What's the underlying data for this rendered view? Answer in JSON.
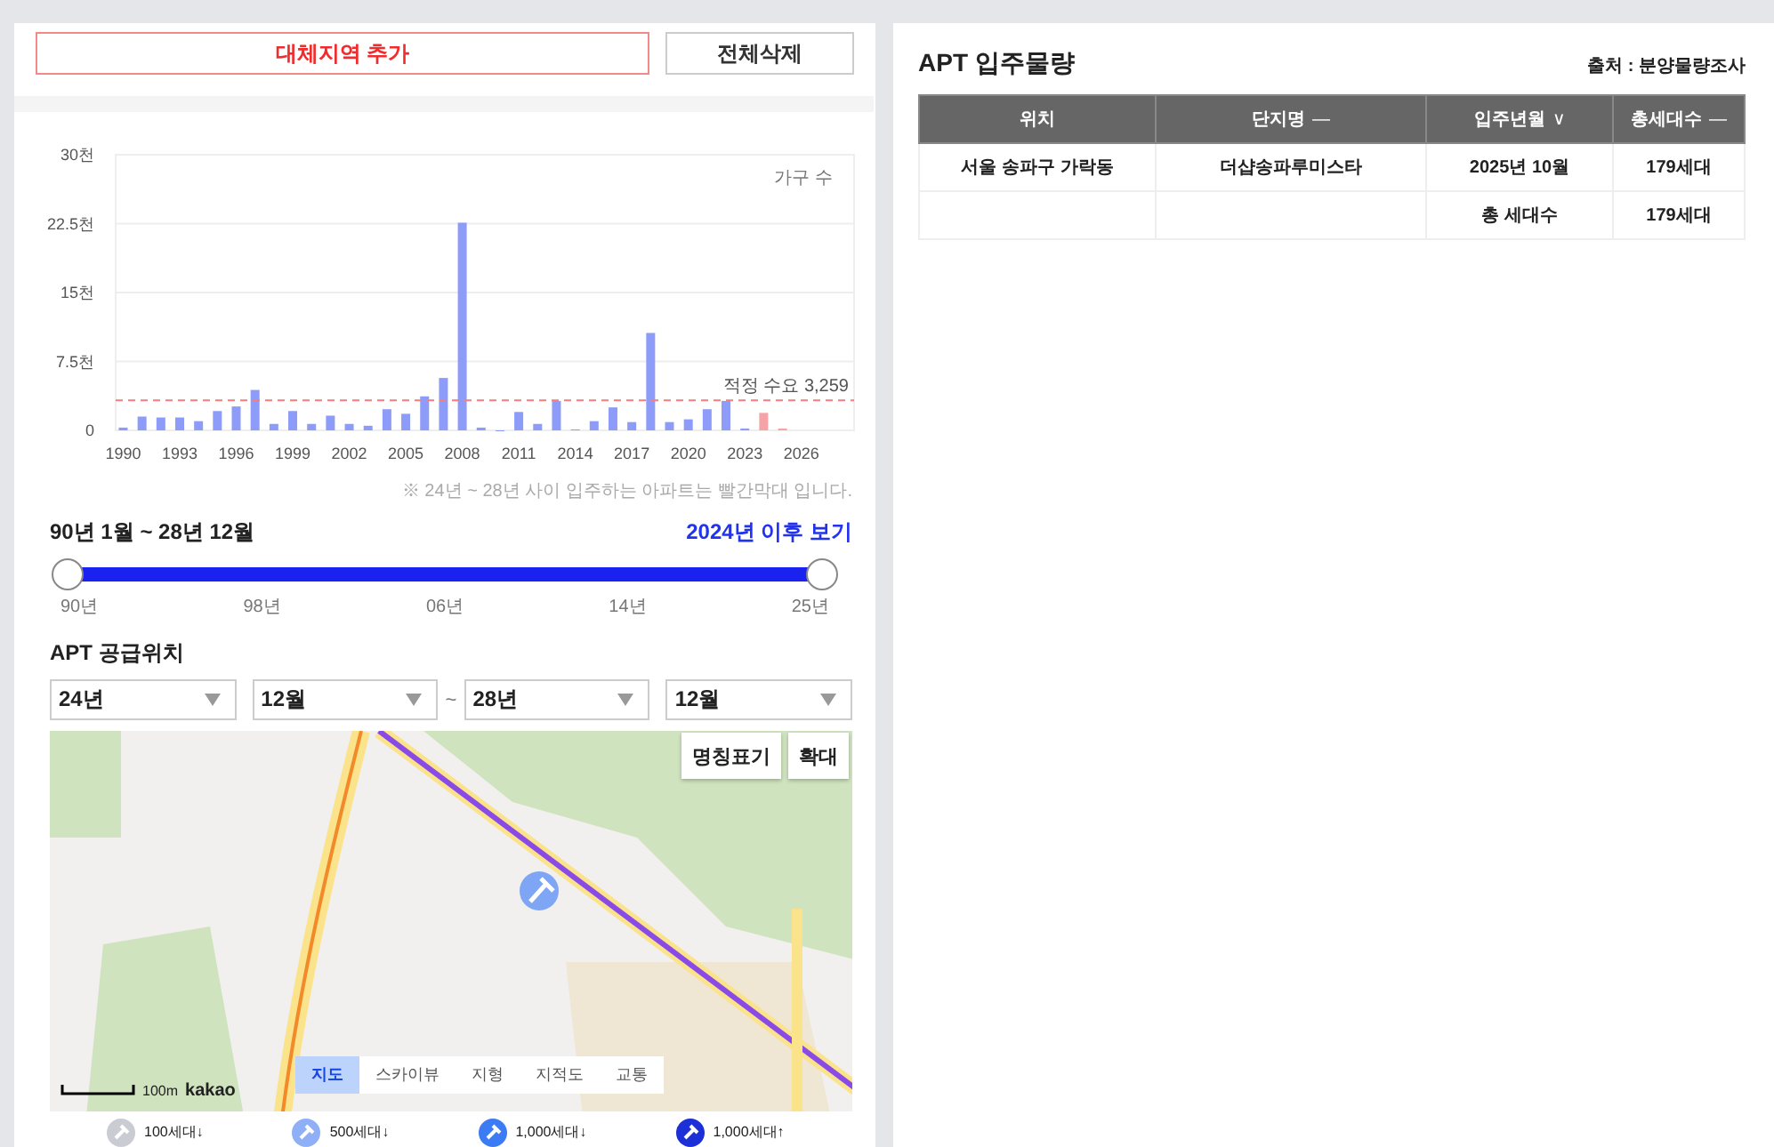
{
  "left_panel": {
    "buttons": [
      {
        "label": "대체지역 추가",
        "kind": "primary"
      },
      {
        "label": "전체삭제",
        "kind": "plain"
      }
    ],
    "chart": {
      "chart_data": {
        "type": "bar",
        "ylabel": "가구 수",
        "x": [
          1990,
          1991,
          1992,
          1993,
          1994,
          1995,
          1996,
          1997,
          1998,
          1999,
          2000,
          2001,
          2002,
          2003,
          2004,
          2005,
          2006,
          2007,
          2008,
          2009,
          2010,
          2011,
          2012,
          2013,
          2014,
          2015,
          2016,
          2017,
          2018,
          2019,
          2020,
          2021,
          2022,
          2023,
          2024,
          2025
        ],
        "series": [
          {
            "color": "#8c9cf8",
            "values": [
              0.3,
              1.5,
              1.4,
              1.4,
              1.0,
              2.1,
              2.6,
              4.4,
              0.7,
              2.1,
              0.7,
              1.6,
              0.7,
              0.5,
              2.3,
              1.8,
              3.7,
              5.7,
              22.6,
              0.3,
              0,
              2.0,
              0.7,
              3.2,
              0.1,
              1.0,
              2.5,
              0.9,
              10.6,
              0.9,
              1.2,
              2.3,
              3.2,
              0.2,
              null,
              null
            ]
          },
          {
            "color": "#f6a3a8",
            "values": [
              null,
              null,
              null,
              null,
              null,
              null,
              null,
              null,
              null,
              null,
              null,
              null,
              null,
              null,
              null,
              null,
              null,
              null,
              null,
              null,
              null,
              null,
              null,
              null,
              null,
              null,
              null,
              null,
              null,
              null,
              null,
              null,
              null,
              null,
              1.9,
              0.2
            ]
          }
        ],
        "stacked": true,
        "xlim": [
          1989.6,
          2028.8
        ],
        "ylim": [
          0,
          30
        ],
        "xticks": [
          1990,
          1993,
          1996,
          1999,
          2002,
          2005,
          2008,
          2011,
          2014,
          2017,
          2020,
          2023,
          2026
        ],
        "yticks": [
          {
            "value": 0,
            "label": "0"
          },
          {
            "value": 7.5,
            "label": "7.5천"
          },
          {
            "value": 15,
            "label": "15천"
          },
          {
            "value": 22.5,
            "label": "22.5천"
          },
          {
            "value": 30,
            "label": "30천"
          }
        ],
        "grid": true,
        "ref_lines": [
          {
            "axis": "y",
            "value": 3.259,
            "label": "적정 수요 3,259"
          }
        ]
      },
      "note": "※ 24년 ~ 28년 사이 입주하는 아파트는 빨간막대 입니다."
    },
    "period": {
      "label": "90년 1월 ~ 28년 12월",
      "link": "2024년 이후 보기",
      "handles": [
        {
          "level": 0
        },
        {
          "level": 1
        }
      ],
      "ticks": [
        "90년",
        "98년",
        "06년",
        "14년",
        "25년"
      ]
    },
    "supply": {
      "title": "APT 공급위치",
      "selects": [
        {
          "value": "24년"
        },
        {
          "value": "12월"
        },
        {
          "value": "28년"
        },
        {
          "value": "12월"
        }
      ],
      "separator": "~",
      "map": {
        "buttons": [
          "명칭표기",
          "확대"
        ],
        "tabs": [
          {
            "label": "지도",
            "selected": true
          },
          {
            "label": "스카이뷰",
            "selected": false
          },
          {
            "label": "지형",
            "selected": false
          },
          {
            "label": "지적도",
            "selected": false
          },
          {
            "label": "교통",
            "selected": false
          }
        ],
        "scale": "100m",
        "logo": "kakao"
      },
      "legend": [
        {
          "label": "100세대↓",
          "color": "#c9ccd3"
        },
        {
          "label": "500세대↓",
          "color": "#8fb0f7"
        },
        {
          "label": "1,000세대↓",
          "color": "#3b7bf3"
        },
        {
          "label": "1,000세대↑",
          "color": "#1d2fd6"
        }
      ]
    }
  },
  "right_panel": {
    "title": "APT 입주물량",
    "source": "출처 : 분양물량조사",
    "table": {
      "columns": [
        {
          "label": "위치"
        },
        {
          "label": "단지명",
          "sort_mark": "—"
        },
        {
          "label": "입주년월",
          "sort_mark": "∨"
        },
        {
          "label": "총세대수",
          "sort_mark": "—"
        }
      ],
      "rows": [
        [
          "서울 송파구 가락동",
          "더샵송파루미스타",
          "2025년 10월",
          "179세대"
        ]
      ],
      "total": {
        "label": "총 세대수",
        "value": "179세대"
      }
    }
  }
}
